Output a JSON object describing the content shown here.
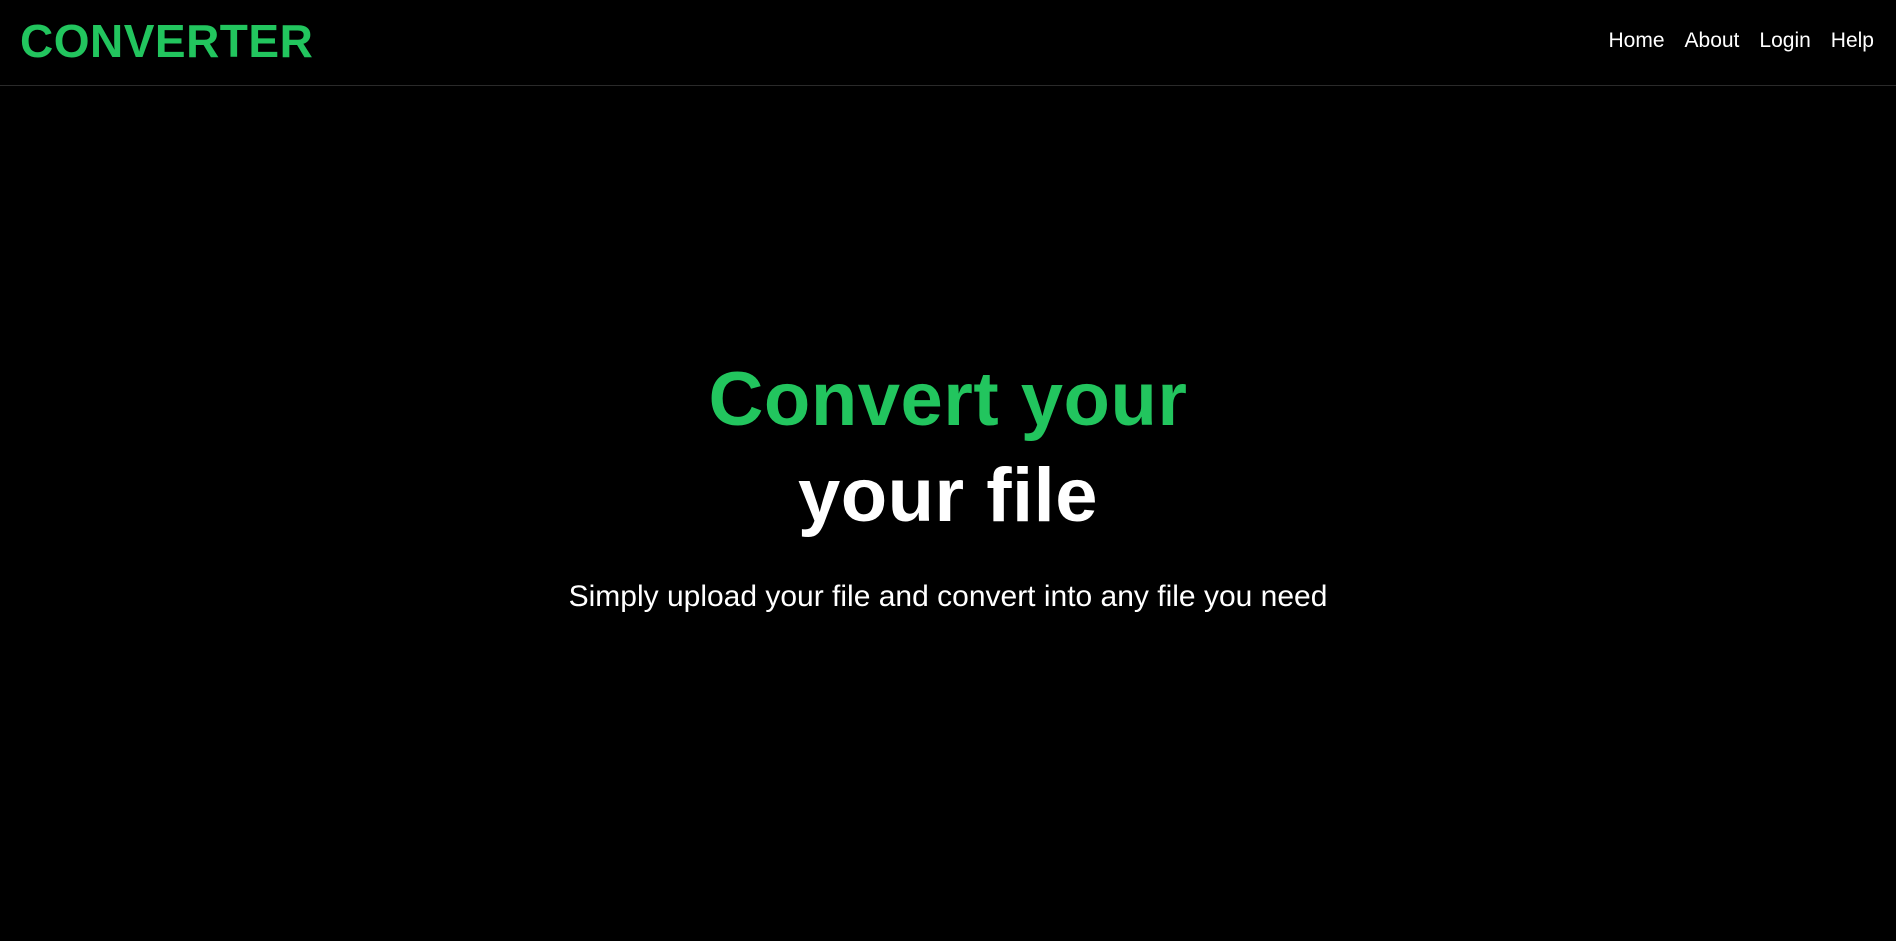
{
  "colors": {
    "background": "#000000",
    "accent": "#22c55e",
    "text": "#ffffff"
  },
  "header": {
    "brand": "CONVERTER",
    "nav": [
      "Home",
      "About",
      "Login",
      "Help"
    ]
  },
  "hero": {
    "line1": "Convert your",
    "line2": "your file",
    "subtitle": "Simply upload your file and convert into any file you need"
  }
}
